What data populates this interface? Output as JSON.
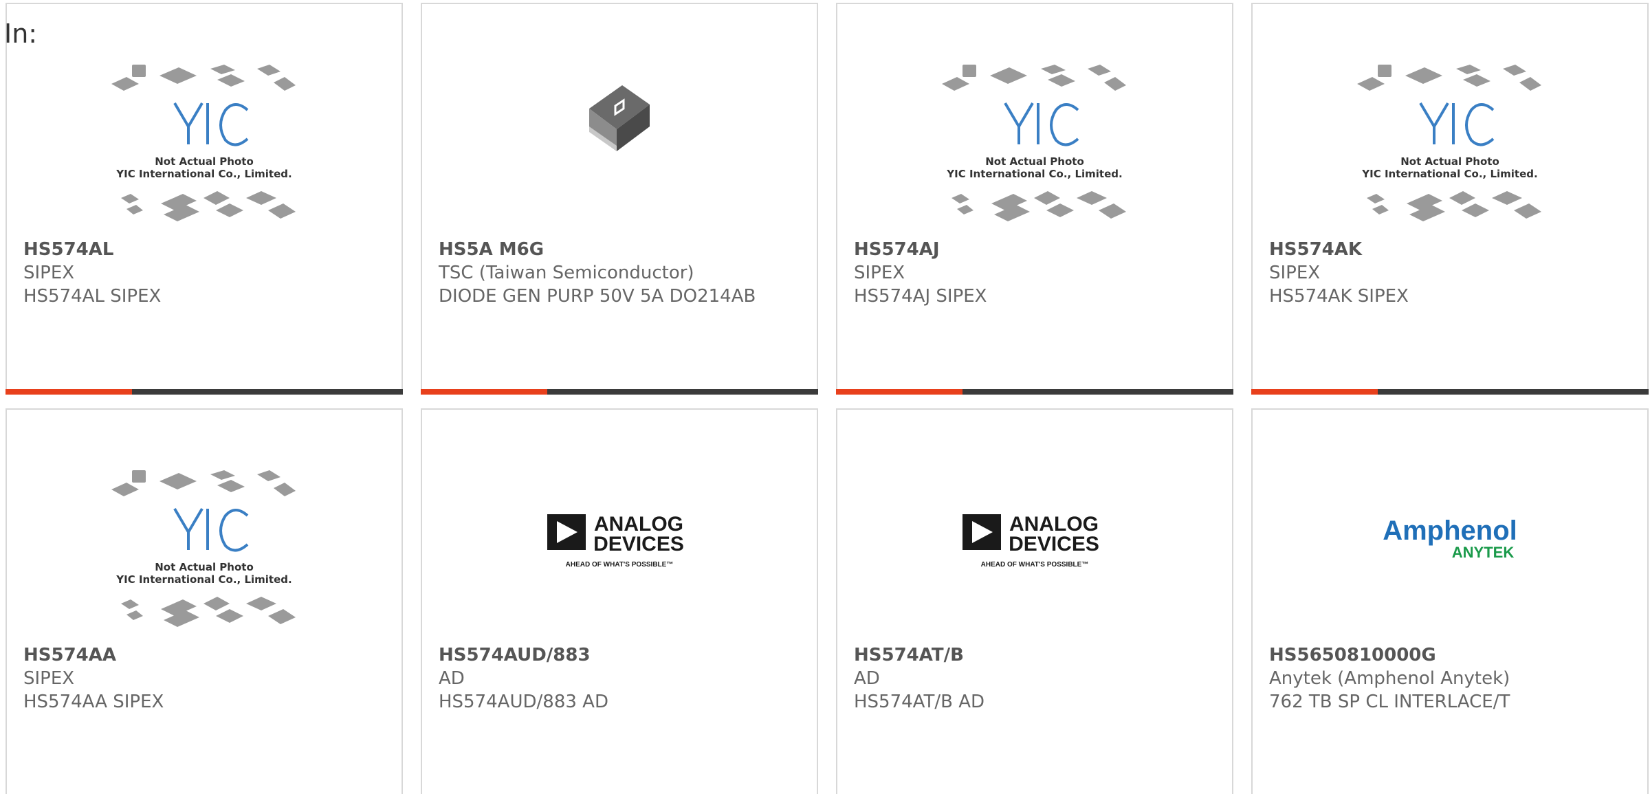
{
  "header": {
    "in_label": "In:"
  },
  "colors": {
    "accent": "#e8401c",
    "bar": "#3b3b3b",
    "border": "#d8d8d8"
  },
  "products": [
    {
      "part_number": "HS574AL",
      "manufacturer": "SIPEX",
      "description": "HS574AL SIPEX",
      "image": "yic-placeholder",
      "image_caption_1": "Not Actual Photo",
      "image_caption_2": "YIC International Co., Limited.",
      "logo_text": "YIC"
    },
    {
      "part_number": "HS5A M6G",
      "manufacturer": "TSC (Taiwan Semiconductor)",
      "description": "DIODE GEN PURP 50V 5A DO214AB",
      "image": "chip-photo"
    },
    {
      "part_number": "HS574AJ",
      "manufacturer": "SIPEX",
      "description": "HS574AJ SIPEX",
      "image": "yic-placeholder",
      "image_caption_1": "Not Actual Photo",
      "image_caption_2": "YIC International Co., Limited.",
      "logo_text": "YIC"
    },
    {
      "part_number": "HS574AK",
      "manufacturer": "SIPEX",
      "description": "HS574AK SIPEX",
      "image": "yic-placeholder",
      "image_caption_1": "Not Actual Photo",
      "image_caption_2": "YIC International Co., Limited.",
      "logo_text": "YIC"
    },
    {
      "part_number": "HS574AA",
      "manufacturer": "SIPEX",
      "description": "HS574AA SIPEX",
      "image": "yic-placeholder",
      "image_caption_1": "Not Actual Photo",
      "image_caption_2": "YIC International Co., Limited.",
      "logo_text": "YIC"
    },
    {
      "part_number": "HS574AUD/883",
      "manufacturer": "AD",
      "description": "HS574AUD/883 AD",
      "image": "analog-devices-logo",
      "logo_line1": "ANALOG",
      "logo_line2": "DEVICES",
      "logo_tagline": "AHEAD OF WHAT'S POSSIBLE™"
    },
    {
      "part_number": "HS574AT/B",
      "manufacturer": "AD",
      "description": "HS574AT/B AD",
      "image": "analog-devices-logo",
      "logo_line1": "ANALOG",
      "logo_line2": "DEVICES",
      "logo_tagline": "AHEAD OF WHAT'S POSSIBLE™"
    },
    {
      "part_number": "HS5650810000G",
      "manufacturer": "Anytek (Amphenol Anytek)",
      "description": "762 TB SP CL INTERLACE/T",
      "image": "amphenol-logo",
      "logo_line1": "Amphenol",
      "logo_line2": "ANYTEK"
    }
  ]
}
